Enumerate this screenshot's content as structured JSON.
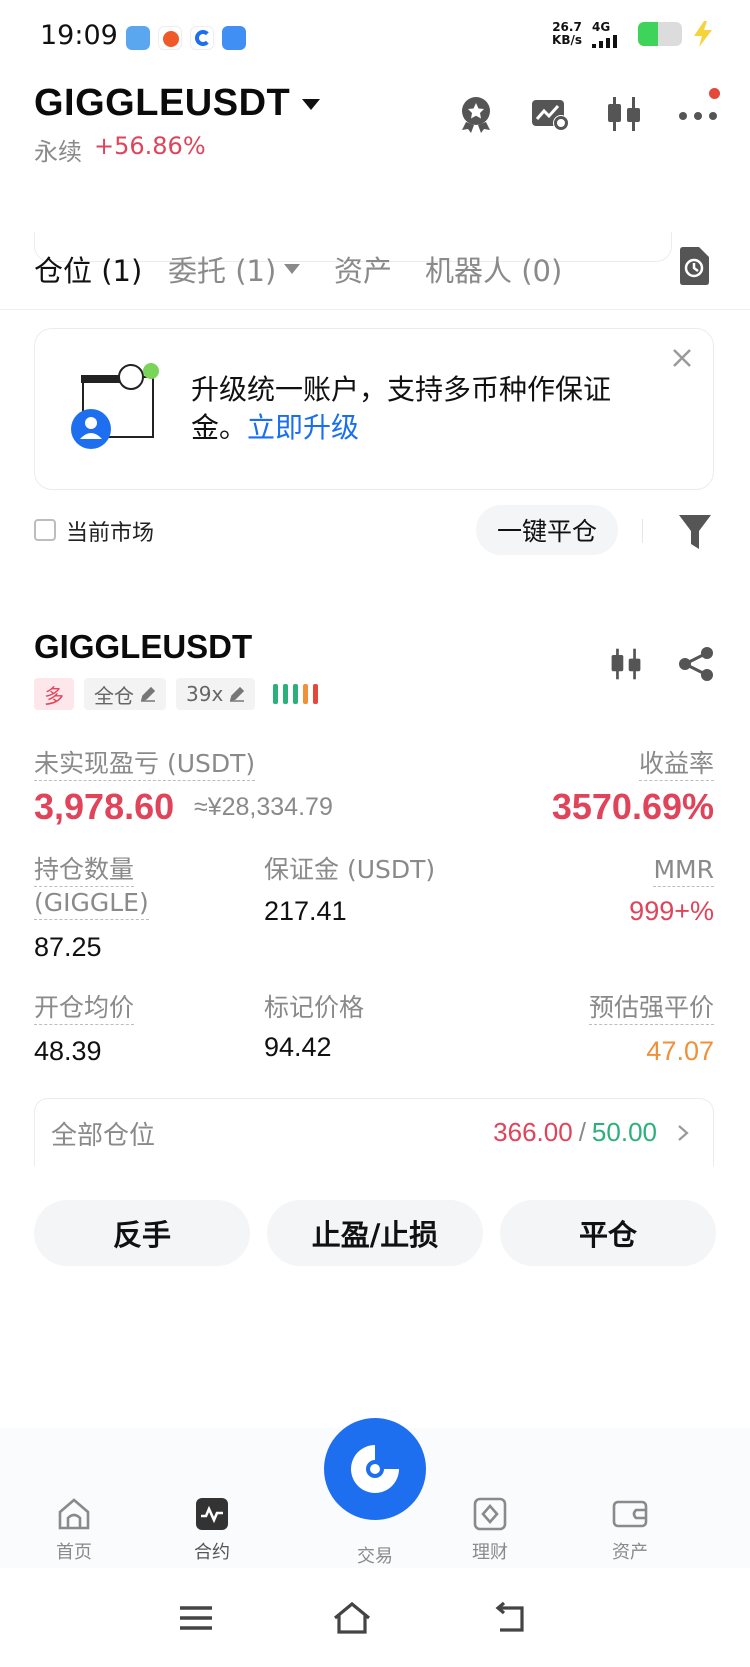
{
  "status_bar": {
    "time": "19:09",
    "net_speed_value": "26.7",
    "net_speed_unit": "KB/s",
    "network": "4G",
    "battery_level": 0.45
  },
  "header": {
    "symbol": "GIGGLEUSDT",
    "contract_type": "永续",
    "change_pct": "+56.86%",
    "icons": [
      "badge-icon",
      "chart-settings-icon",
      "candlestick-icon",
      "more-icon"
    ]
  },
  "tabs": [
    {
      "label": "仓位 (1)",
      "active": true
    },
    {
      "label": "委托 (1)",
      "active": false,
      "dropdown": true
    },
    {
      "label": "资产",
      "active": false
    },
    {
      "label": "机器人 (0)",
      "active": false
    }
  ],
  "banner": {
    "text": "升级统一账户，支持多币种作保证金。",
    "link": "立即升级"
  },
  "filter": {
    "current_market_label": "当前市场",
    "close_all_label": "一键平仓"
  },
  "position": {
    "symbol": "GIGGLEUSDT",
    "side_tag": "多",
    "margin_mode_tag": "全仓",
    "leverage_tag": "39x",
    "risk_level": 5,
    "unrealized_pnl_label": "未实现盈亏 (USDT)",
    "unrealized_pnl": "3,978.60",
    "unrealized_pnl_cny": "≈¥28,334.79",
    "roe_label": "收益率",
    "roe": "3570.69%",
    "qty_label_1": "持仓数量",
    "qty_label_2": "(GIGGLE)",
    "qty": "87.25",
    "margin_label": "保证金 (USDT)",
    "margin": "217.41",
    "mmr_label": "MMR",
    "mmr": "999+%",
    "entry_label": "开仓均价",
    "entry": "48.39",
    "mark_label": "标记价格",
    "mark": "94.42",
    "liq_label": "预估强平价",
    "liq": "47.07"
  },
  "all_positions": {
    "label": "全部仓位",
    "long_value": "366.00",
    "separator": "/",
    "short_value": "50.00"
  },
  "actions": {
    "reverse": "反手",
    "tpsl": "止盈/止损",
    "close": "平仓"
  },
  "bottom_nav": [
    {
      "label": "首页",
      "icon": "home-icon"
    },
    {
      "label": "合约",
      "icon": "futures-icon",
      "active": true
    },
    {
      "label": "交易",
      "icon": "trade-icon"
    },
    {
      "label": "理财",
      "icon": "earn-icon"
    },
    {
      "label": "资产",
      "icon": "wallet-icon"
    }
  ],
  "colors": {
    "up": "#e0445a",
    "down": "#2bb07a",
    "warn": "#f0913a",
    "brand": "#1e6ff0"
  }
}
